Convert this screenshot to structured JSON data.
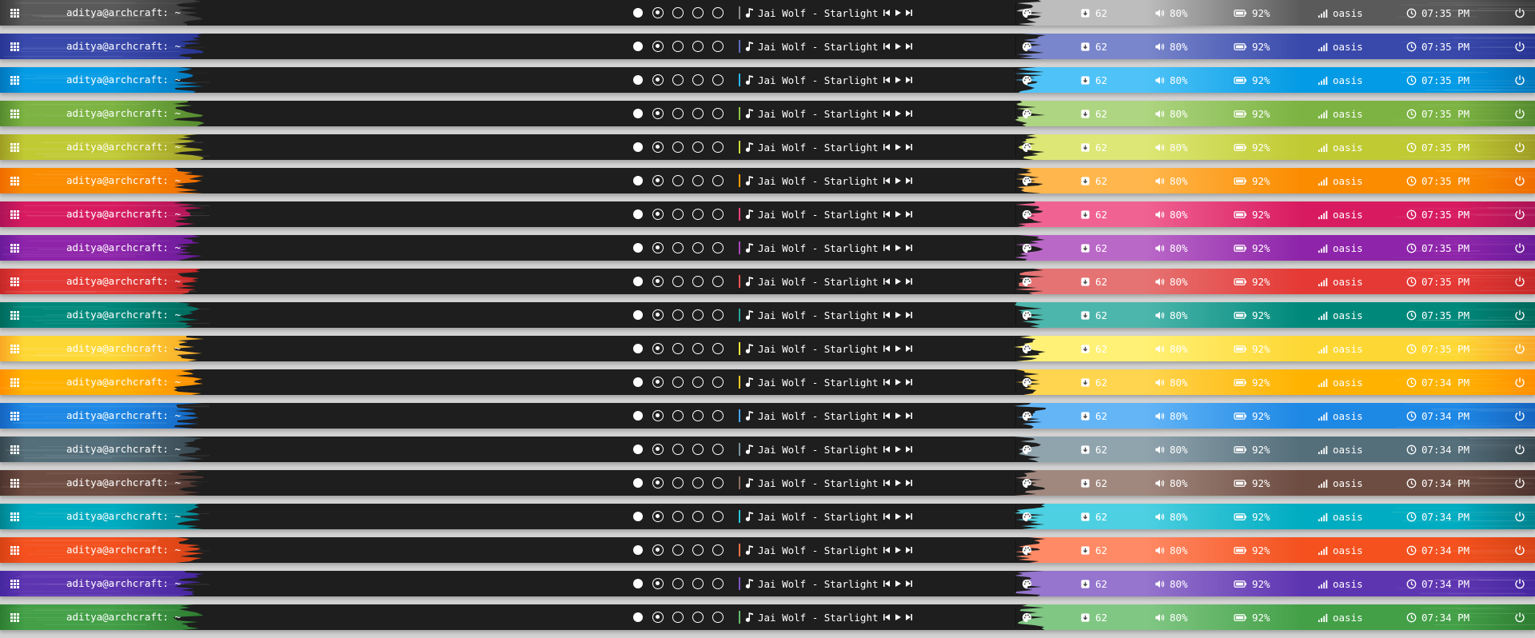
{
  "bar": {
    "title": "aditya@archcraft: ~",
    "song": "Jai Wolf - Starlight",
    "modules": {
      "packages": "62",
      "volume": "80%",
      "battery": "92%",
      "network": "oasis"
    },
    "background_color": "#1e1e1e"
  },
  "icons": {
    "menu": "apps-grid-icon",
    "music": "music-note-icon",
    "prev": "skip-previous-icon",
    "play": "play-icon",
    "next": "skip-next-icon",
    "theme": "palette-icon",
    "packages": "package-icon",
    "volume": "speaker-icon",
    "battery": "battery-icon",
    "network": "signal-icon",
    "clock": "clock-icon",
    "power": "power-icon"
  },
  "themes": [
    {
      "name": "grey",
      "dark": "#3a3a3a",
      "mid": "#5a5a5a",
      "light": "#bdbdbd",
      "accent": "#8a8a8a",
      "time": "07:35 PM"
    },
    {
      "name": "indigo",
      "dark": "#283593",
      "mid": "#3949ab",
      "light": "#7986cb",
      "accent": "#5c6bc0",
      "time": "07:35 PM"
    },
    {
      "name": "light-blue",
      "dark": "#0277bd",
      "mid": "#039be5",
      "light": "#4fc3f7",
      "accent": "#29b6f6",
      "time": "07:35 PM"
    },
    {
      "name": "light-green",
      "dark": "#558b2f",
      "mid": "#7cb342",
      "light": "#aed581",
      "accent": "#8bc34a",
      "time": "07:35 PM"
    },
    {
      "name": "lime",
      "dark": "#9e9d24",
      "mid": "#c0ca33",
      "light": "#dce775",
      "accent": "#cddc39",
      "time": "07:35 PM"
    },
    {
      "name": "orange",
      "dark": "#ef6c00",
      "mid": "#fb8c00",
      "light": "#ffb74d",
      "accent": "#ff9800",
      "time": "07:35 PM"
    },
    {
      "name": "pink",
      "dark": "#ad1457",
      "mid": "#d81b60",
      "light": "#f06292",
      "accent": "#ec407a",
      "time": "07:35 PM"
    },
    {
      "name": "purple",
      "dark": "#6a1b9a",
      "mid": "#8e24aa",
      "light": "#ba68c8",
      "accent": "#ab47bc",
      "time": "07:35 PM"
    },
    {
      "name": "red",
      "dark": "#c62828",
      "mid": "#e53935",
      "light": "#e57373",
      "accent": "#ef5350",
      "time": "07:35 PM"
    },
    {
      "name": "teal",
      "dark": "#00695c",
      "mid": "#00897b",
      "light": "#4db6ac",
      "accent": "#26a69a",
      "time": "07:35 PM"
    },
    {
      "name": "yellow",
      "dark": "#f9a825",
      "mid": "#fdd835",
      "light": "#fff176",
      "accent": "#ffeb3b",
      "time": "07:35 PM"
    },
    {
      "name": "amber",
      "dark": "#ff8f00",
      "mid": "#ffb300",
      "light": "#ffd54f",
      "accent": "#ffca28",
      "time": "07:34 PM"
    },
    {
      "name": "blue",
      "dark": "#1565c0",
      "mid": "#1e88e5",
      "light": "#64b5f6",
      "accent": "#42a5f5",
      "time": "07:34 PM"
    },
    {
      "name": "blue-grey",
      "dark": "#37474f",
      "mid": "#546e7a",
      "light": "#90a4ae",
      "accent": "#78909c",
      "time": "07:34 PM"
    },
    {
      "name": "brown",
      "dark": "#4e342e",
      "mid": "#6d4c41",
      "light": "#a1887f",
      "accent": "#8d6e63",
      "time": "07:34 PM"
    },
    {
      "name": "cyan",
      "dark": "#00838f",
      "mid": "#00acc1",
      "light": "#4dd0e1",
      "accent": "#26c6da",
      "time": "07:34 PM"
    },
    {
      "name": "deep-orange",
      "dark": "#d84315",
      "mid": "#f4511e",
      "light": "#ff8a65",
      "accent": "#ff7043",
      "time": "07:34 PM"
    },
    {
      "name": "deep-purple",
      "dark": "#4527a0",
      "mid": "#5e35b1",
      "light": "#9575cd",
      "accent": "#7e57c2",
      "time": "07:34 PM"
    },
    {
      "name": "green",
      "dark": "#2e7d32",
      "mid": "#43a047",
      "light": "#81c784",
      "accent": "#66bb6a",
      "time": "07:34 PM"
    }
  ]
}
